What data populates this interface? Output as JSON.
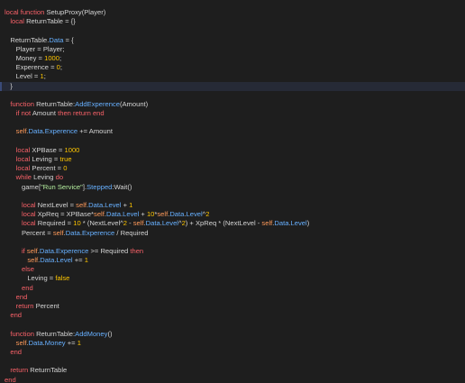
{
  "theme": {
    "background": "#1e1e1e",
    "highlight_line": "#262a36",
    "keyword": "#f86168",
    "number": "#ffc600",
    "property": "#67b0ff",
    "self": "#ff9a5a",
    "string": "#b6f0a0",
    "text": "#d4d4d4"
  },
  "code_lines": [
    [
      {
        "t": "local function ",
        "c": "kw"
      },
      {
        "t": "SetupProxy(Player)",
        "c": "plain"
      }
    ],
    [
      {
        "t": "   ",
        "c": "plain"
      },
      {
        "t": "local ",
        "c": "kw"
      },
      {
        "t": "ReturnTable = {}",
        "c": "plain"
      }
    ],
    [],
    [
      {
        "t": "   ReturnTable.",
        "c": "plain"
      },
      {
        "t": "Data",
        "c": "prop"
      },
      {
        "t": " = {",
        "c": "plain"
      }
    ],
    [
      {
        "t": "      Player = Player;",
        "c": "plain"
      }
    ],
    [
      {
        "t": "      Money = ",
        "c": "plain"
      },
      {
        "t": "1000",
        "c": "num"
      },
      {
        "t": ";",
        "c": "plain"
      }
    ],
    [
      {
        "t": "      Experence = ",
        "c": "plain"
      },
      {
        "t": "0",
        "c": "num"
      },
      {
        "t": ";",
        "c": "plain"
      }
    ],
    [
      {
        "t": "      Level = ",
        "c": "plain"
      },
      {
        "t": "1",
        "c": "num"
      },
      {
        "t": ";",
        "c": "plain"
      }
    ],
    [
      {
        "t": "   }",
        "c": "plain"
      }
    ],
    [],
    [
      {
        "t": "   ",
        "c": "plain"
      },
      {
        "t": "function ",
        "c": "kw"
      },
      {
        "t": "ReturnTable:",
        "c": "plain"
      },
      {
        "t": "AddExperence",
        "c": "prop"
      },
      {
        "t": "(Amount)",
        "c": "plain"
      }
    ],
    [
      {
        "t": "      ",
        "c": "plain"
      },
      {
        "t": "if not ",
        "c": "kw"
      },
      {
        "t": "Amount ",
        "c": "plain"
      },
      {
        "t": "then return end",
        "c": "kw"
      }
    ],
    [],
    [
      {
        "t": "      ",
        "c": "plain"
      },
      {
        "t": "self",
        "c": "self"
      },
      {
        "t": ".",
        "c": "plain"
      },
      {
        "t": "Data",
        "c": "prop"
      },
      {
        "t": ".",
        "c": "plain"
      },
      {
        "t": "Experence",
        "c": "prop"
      },
      {
        "t": " += Amount",
        "c": "plain"
      }
    ],
    [],
    [
      {
        "t": "      ",
        "c": "plain"
      },
      {
        "t": "local ",
        "c": "kw"
      },
      {
        "t": "XPBase = ",
        "c": "plain"
      },
      {
        "t": "1000",
        "c": "num"
      }
    ],
    [
      {
        "t": "      ",
        "c": "plain"
      },
      {
        "t": "local ",
        "c": "kw"
      },
      {
        "t": "Leving = ",
        "c": "plain"
      },
      {
        "t": "true",
        "c": "num"
      }
    ],
    [
      {
        "t": "      ",
        "c": "plain"
      },
      {
        "t": "local ",
        "c": "kw"
      },
      {
        "t": "Percent = ",
        "c": "plain"
      },
      {
        "t": "0",
        "c": "num"
      }
    ],
    [
      {
        "t": "      ",
        "c": "plain"
      },
      {
        "t": "while ",
        "c": "kw"
      },
      {
        "t": "Leving ",
        "c": "plain"
      },
      {
        "t": "do",
        "c": "kw"
      }
    ],
    [
      {
        "t": "         game[",
        "c": "plain"
      },
      {
        "t": "\"Run Service\"",
        "c": "str"
      },
      {
        "t": "].",
        "c": "plain"
      },
      {
        "t": "Stepped",
        "c": "prop"
      },
      {
        "t": ":Wait()",
        "c": "plain"
      }
    ],
    [],
    [
      {
        "t": "         ",
        "c": "plain"
      },
      {
        "t": "local ",
        "c": "kw"
      },
      {
        "t": "NextLevel = ",
        "c": "plain"
      },
      {
        "t": "self",
        "c": "self"
      },
      {
        "t": ".",
        "c": "plain"
      },
      {
        "t": "Data",
        "c": "prop"
      },
      {
        "t": ".",
        "c": "plain"
      },
      {
        "t": "Level",
        "c": "prop"
      },
      {
        "t": " + ",
        "c": "plain"
      },
      {
        "t": "1",
        "c": "num"
      }
    ],
    [
      {
        "t": "         ",
        "c": "plain"
      },
      {
        "t": "local ",
        "c": "kw"
      },
      {
        "t": "XpReq = XPBase*",
        "c": "plain"
      },
      {
        "t": "self",
        "c": "self"
      },
      {
        "t": ".",
        "c": "plain"
      },
      {
        "t": "Data",
        "c": "prop"
      },
      {
        "t": ".",
        "c": "plain"
      },
      {
        "t": "Level",
        "c": "prop"
      },
      {
        "t": " + ",
        "c": "plain"
      },
      {
        "t": "10",
        "c": "num"
      },
      {
        "t": "*",
        "c": "plain"
      },
      {
        "t": "self",
        "c": "self"
      },
      {
        "t": ".",
        "c": "plain"
      },
      {
        "t": "Data",
        "c": "prop"
      },
      {
        "t": ".",
        "c": "plain"
      },
      {
        "t": "Level",
        "c": "prop"
      },
      {
        "t": "^",
        "c": "plain"
      },
      {
        "t": "2",
        "c": "num"
      }
    ],
    [
      {
        "t": "         ",
        "c": "plain"
      },
      {
        "t": "local ",
        "c": "kw"
      },
      {
        "t": "Required = ",
        "c": "plain"
      },
      {
        "t": "10",
        "c": "num"
      },
      {
        "t": " * (NextLevel^",
        "c": "plain"
      },
      {
        "t": "2",
        "c": "num"
      },
      {
        "t": " - ",
        "c": "plain"
      },
      {
        "t": "self",
        "c": "self"
      },
      {
        "t": ".",
        "c": "plain"
      },
      {
        "t": "Data",
        "c": "prop"
      },
      {
        "t": ".",
        "c": "plain"
      },
      {
        "t": "Level",
        "c": "prop"
      },
      {
        "t": "^",
        "c": "plain"
      },
      {
        "t": "2",
        "c": "num"
      },
      {
        "t": ") + XpReq * (NextLevel - ",
        "c": "plain"
      },
      {
        "t": "self",
        "c": "self"
      },
      {
        "t": ".",
        "c": "plain"
      },
      {
        "t": "Data",
        "c": "prop"
      },
      {
        "t": ".",
        "c": "plain"
      },
      {
        "t": "Level",
        "c": "prop"
      },
      {
        "t": ")",
        "c": "plain"
      }
    ],
    [
      {
        "t": "         Percent = ",
        "c": "plain"
      },
      {
        "t": "self",
        "c": "self"
      },
      {
        "t": ".",
        "c": "plain"
      },
      {
        "t": "Data",
        "c": "prop"
      },
      {
        "t": ".",
        "c": "plain"
      },
      {
        "t": "Experence",
        "c": "prop"
      },
      {
        "t": " / Required",
        "c": "plain"
      }
    ],
    [],
    [
      {
        "t": "         ",
        "c": "plain"
      },
      {
        "t": "if ",
        "c": "kw"
      },
      {
        "t": "self",
        "c": "self"
      },
      {
        "t": ".",
        "c": "plain"
      },
      {
        "t": "Data",
        "c": "prop"
      },
      {
        "t": ".",
        "c": "plain"
      },
      {
        "t": "Experence",
        "c": "prop"
      },
      {
        "t": " >= Required ",
        "c": "plain"
      },
      {
        "t": "then",
        "c": "kw"
      }
    ],
    [
      {
        "t": "            ",
        "c": "plain"
      },
      {
        "t": "self",
        "c": "self"
      },
      {
        "t": ".",
        "c": "plain"
      },
      {
        "t": "Data",
        "c": "prop"
      },
      {
        "t": ".",
        "c": "plain"
      },
      {
        "t": "Level",
        "c": "prop"
      },
      {
        "t": " += ",
        "c": "plain"
      },
      {
        "t": "1",
        "c": "num"
      }
    ],
    [
      {
        "t": "         ",
        "c": "plain"
      },
      {
        "t": "else",
        "c": "kw"
      }
    ],
    [
      {
        "t": "            Leving = ",
        "c": "plain"
      },
      {
        "t": "false",
        "c": "num"
      }
    ],
    [
      {
        "t": "         ",
        "c": "plain"
      },
      {
        "t": "end",
        "c": "kw"
      }
    ],
    [
      {
        "t": "      ",
        "c": "plain"
      },
      {
        "t": "end",
        "c": "kw"
      }
    ],
    [
      {
        "t": "      ",
        "c": "plain"
      },
      {
        "t": "return ",
        "c": "kw"
      },
      {
        "t": "Percent",
        "c": "plain"
      }
    ],
    [
      {
        "t": "   ",
        "c": "plain"
      },
      {
        "t": "end",
        "c": "kw"
      }
    ],
    [],
    [
      {
        "t": "   ",
        "c": "plain"
      },
      {
        "t": "function ",
        "c": "kw"
      },
      {
        "t": "ReturnTable:",
        "c": "plain"
      },
      {
        "t": "AddMoney",
        "c": "prop"
      },
      {
        "t": "()",
        "c": "plain"
      }
    ],
    [
      {
        "t": "      ",
        "c": "plain"
      },
      {
        "t": "self",
        "c": "self"
      },
      {
        "t": ".",
        "c": "plain"
      },
      {
        "t": "Data",
        "c": "prop"
      },
      {
        "t": ".",
        "c": "plain"
      },
      {
        "t": "Money",
        "c": "prop"
      },
      {
        "t": " += ",
        "c": "plain"
      },
      {
        "t": "1",
        "c": "num"
      }
    ],
    [
      {
        "t": "   ",
        "c": "plain"
      },
      {
        "t": "end",
        "c": "kw"
      }
    ],
    [],
    [
      {
        "t": "   ",
        "c": "plain"
      },
      {
        "t": "return ",
        "c": "kw"
      },
      {
        "t": "ReturnTable",
        "c": "plain"
      }
    ],
    [
      {
        "t": "end",
        "c": "kw"
      }
    ]
  ],
  "highlighted_line_index": 8
}
